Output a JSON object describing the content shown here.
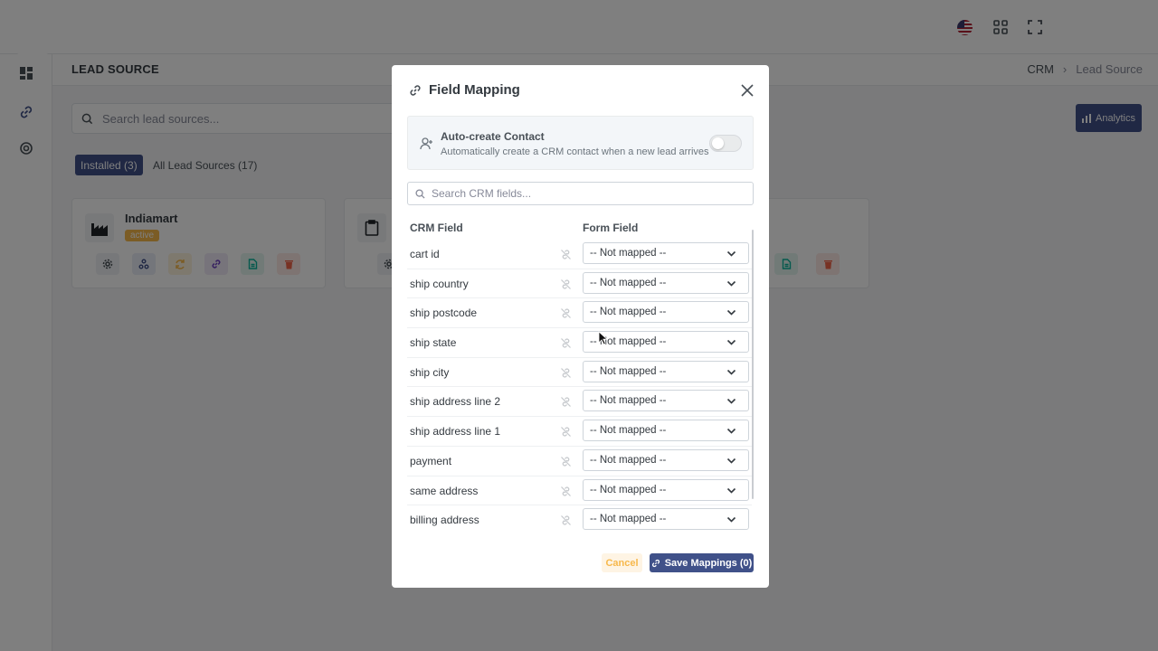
{
  "header": {
    "page_title": "LEAD SOURCE"
  },
  "breadcrumb": {
    "root": "CRM",
    "current": "Lead Source"
  },
  "toolbar": {
    "search_placeholder": "Search lead sources...",
    "analytics_label": "Analytics"
  },
  "tabs": {
    "installed": "Installed (3)",
    "all": "All Lead Sources (17)"
  },
  "cards": [
    {
      "name": "Indiamart",
      "status": "active"
    }
  ],
  "modal": {
    "title": "Field Mapping",
    "auto_create": {
      "title": "Auto-create Contact",
      "subtitle": "Automatically create a CRM contact when a new lead arrives",
      "enabled": false
    },
    "search_placeholder": "Search CRM fields...",
    "columns": {
      "crm_field": "CRM Field",
      "form_field": "Form Field"
    },
    "rows": [
      {
        "field": "cart id",
        "mapping": "-- Not mapped --"
      },
      {
        "field": "ship country",
        "mapping": "-- Not mapped --"
      },
      {
        "field": "ship postcode",
        "mapping": "-- Not mapped --"
      },
      {
        "field": "ship state",
        "mapping": "-- Not mapped --"
      },
      {
        "field": "ship city",
        "mapping": "-- Not mapped --"
      },
      {
        "field": "ship address line 2",
        "mapping": "-- Not mapped --"
      },
      {
        "field": "ship address line 1",
        "mapping": "-- Not mapped --"
      },
      {
        "field": "payment",
        "mapping": "-- Not mapped --"
      },
      {
        "field": "same address",
        "mapping": "-- Not mapped --"
      },
      {
        "field": "billing address",
        "mapping": "-- Not mapped --"
      }
    ],
    "cancel_label": "Cancel",
    "save_label": "Save Mappings (0)"
  },
  "colors": {
    "primary": "#405189",
    "warning": "#f7b84b",
    "danger": "#f06548",
    "success": "#0ab39c"
  }
}
